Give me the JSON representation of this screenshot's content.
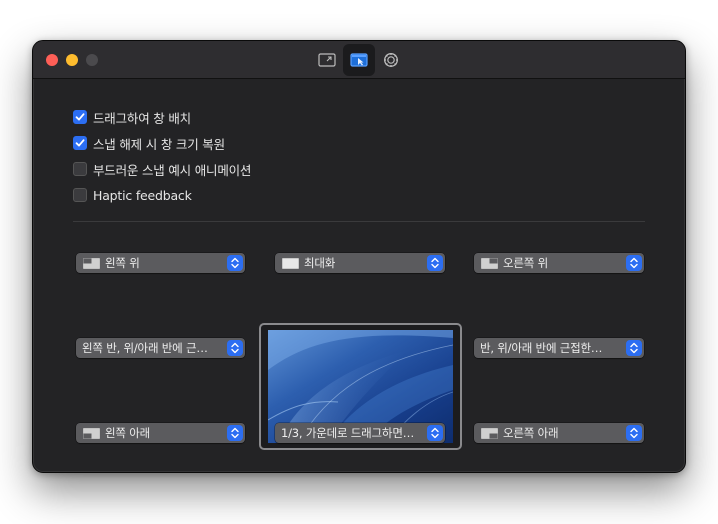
{
  "toolbar": {
    "tabs": [
      {
        "name": "general",
        "icon": "window-arrow-icon",
        "active": false
      },
      {
        "name": "snap",
        "icon": "window-cursor-icon",
        "active": true
      },
      {
        "name": "settings",
        "icon": "gear-icon",
        "active": false
      }
    ]
  },
  "options": [
    {
      "label": "드래그하여 창 배치",
      "checked": true
    },
    {
      "label": "스냅 해제 시 창 크기 복원",
      "checked": true
    },
    {
      "label": "부드러운 스냅 예시 애니메이션",
      "checked": false
    },
    {
      "label": "Haptic feedback",
      "checked": false
    }
  ],
  "snap_areas": {
    "top_left": "왼쪽 위",
    "top_center": "최대화",
    "top_right": "오른쪽 위",
    "middle_left": "왼쪽 반, 위/아래 반에 근…",
    "middle_right": "반, 위/아래 반에 근접한…",
    "bottom_left": "왼쪽 아래",
    "bottom_center": "1/3, 가운데로 드래그하면…",
    "bottom_right": "오른쪽 아래"
  },
  "colors": {
    "accent": "#2c6ef2",
    "window_bg": "#232325"
  }
}
